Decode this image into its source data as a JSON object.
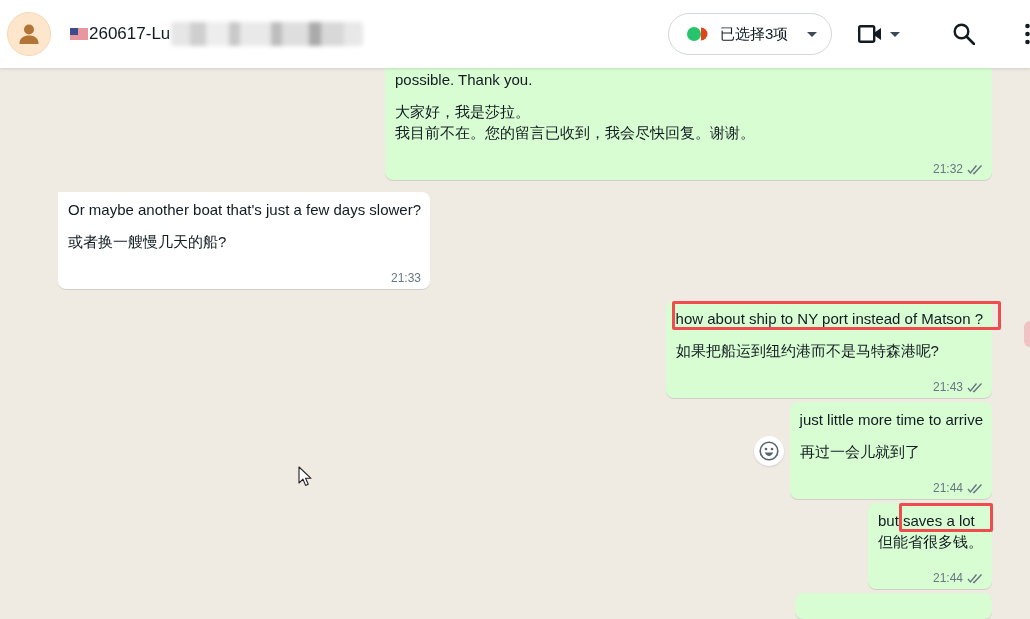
{
  "header": {
    "contact_name": "260617-Lu",
    "selection_button": {
      "label": "已选择3项"
    }
  },
  "messages": [
    {
      "kind": "outgoing",
      "paragraphs": [
        {
          "lines": [
            {
              "text": "possible. Thank you."
            }
          ]
        },
        {
          "lines": [
            {
              "text": "大家好，我是莎拉。"
            },
            {
              "text": "我目前不在。您的留言已收到，我会尽快回复。谢谢。"
            }
          ]
        }
      ],
      "time": "21:32",
      "read": false
    },
    {
      "kind": "incoming",
      "paragraphs": [
        {
          "lines": [
            {
              "text": "Or maybe another boat that's just a few days slower?"
            }
          ]
        },
        {
          "lines": [
            {
              "text": "或者换一艘慢几天的船?"
            }
          ]
        }
      ],
      "time": "21:33"
    },
    {
      "kind": "outgoing",
      "edge_marker": true,
      "paragraphs": [
        {
          "lines": [
            {
              "segments": [
                {
                  "text": "how about ship to NY port instead of Matson ?",
                  "marked": true
                }
              ]
            }
          ]
        },
        {
          "lines": [
            {
              "text": "如果把船运到纽约港而不是马特森港呢?"
            }
          ]
        }
      ],
      "time": "21:43",
      "read": false
    },
    {
      "kind": "outgoing",
      "reaction_button": true,
      "paragraphs": [
        {
          "lines": [
            {
              "text": "just little more time to arrive"
            }
          ]
        },
        {
          "lines": [
            {
              "text": "再过一会儿就到了"
            }
          ]
        }
      ],
      "time": "21:44",
      "read": false
    },
    {
      "kind": "outgoing",
      "paragraphs": [
        {
          "lines": [
            {
              "segments": [
                {
                  "text": "but ",
                  "marked": false
                },
                {
                  "text": "saves a lot",
                  "marked": true
                }
              ]
            },
            {
              "text": "但能省很多钱。"
            }
          ]
        }
      ],
      "time": "21:44",
      "read": false
    },
    {
      "kind": "outgoing"
    }
  ]
}
